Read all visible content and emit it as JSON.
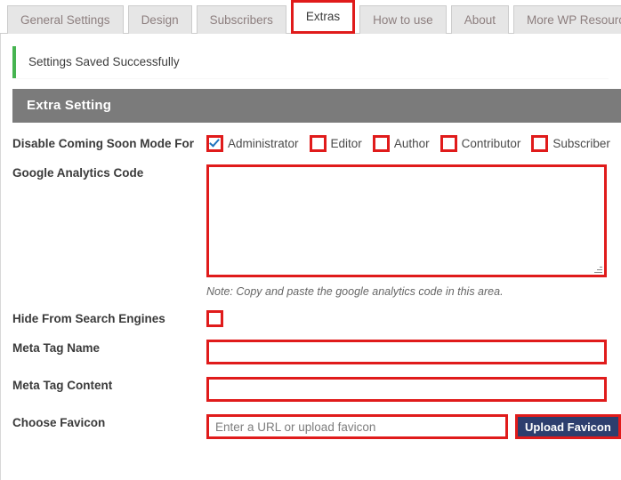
{
  "tabs": [
    {
      "label": "General Settings",
      "active": false
    },
    {
      "label": "Design",
      "active": false
    },
    {
      "label": "Subscribers",
      "active": false
    },
    {
      "label": "Extras",
      "active": true
    },
    {
      "label": "How to use",
      "active": false
    },
    {
      "label": "About",
      "active": false
    },
    {
      "label": "More WP Resources",
      "active": false
    }
  ],
  "notice": {
    "message": "Settings Saved Successfully",
    "accent_color": "#46b450"
  },
  "section": {
    "title": "Extra Setting",
    "bg_color": "#7b7b7b"
  },
  "colors": {
    "highlight_border": "#e01b1b",
    "button_primary": "#2d3e6e",
    "checkmark": "#1e73be"
  },
  "fields": {
    "disable_coming_soon": {
      "label": "Disable Coming Soon Mode For",
      "options": [
        {
          "label": "Administrator",
          "checked": true
        },
        {
          "label": "Editor",
          "checked": false
        },
        {
          "label": "Author",
          "checked": false
        },
        {
          "label": "Contributor",
          "checked": false
        },
        {
          "label": "Subscriber",
          "checked": false
        }
      ]
    },
    "google_analytics": {
      "label": "Google Analytics Code",
      "value": "",
      "placeholder": "",
      "note": "Note: Copy and paste the google analytics code in this area."
    },
    "hide_from_search": {
      "label": "Hide From Search Engines",
      "checked": false
    },
    "meta_tag_name": {
      "label": "Meta Tag Name",
      "value": "",
      "placeholder": ""
    },
    "meta_tag_content": {
      "label": "Meta Tag Content",
      "value": "",
      "placeholder": ""
    },
    "favicon": {
      "label": "Choose Favicon",
      "value": "",
      "placeholder": "Enter a URL or upload favicon",
      "button_label": "Upload Favicon"
    }
  }
}
